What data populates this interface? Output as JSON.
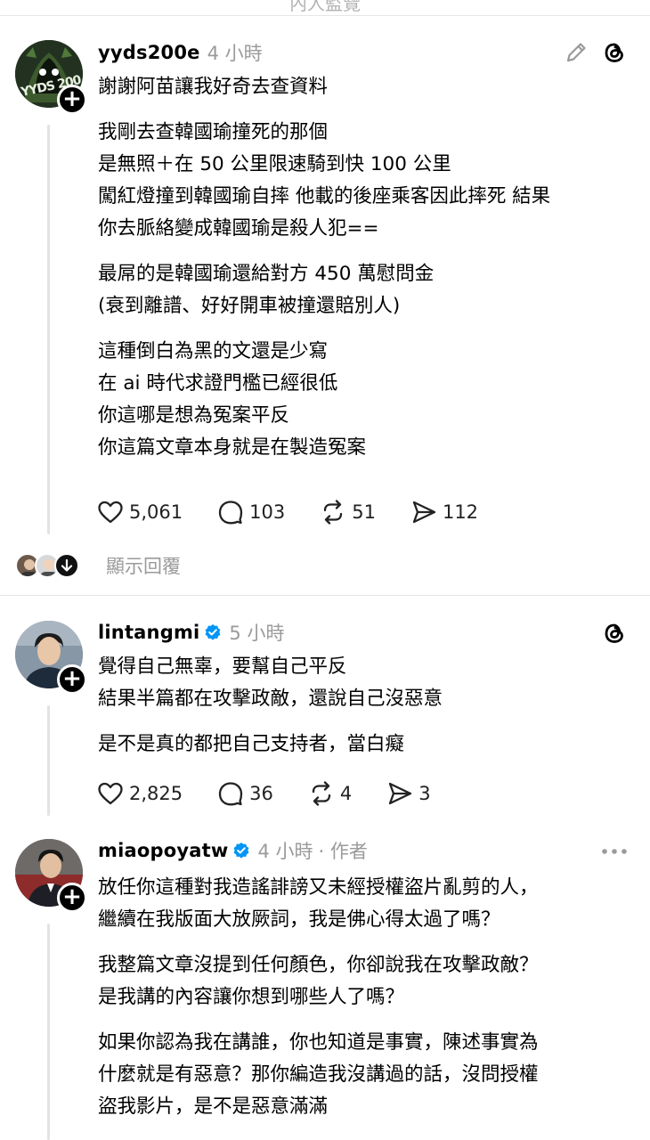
{
  "top_cut_text": "內人監覽",
  "posts": [
    {
      "username": "yyds200e",
      "time": "4 小時",
      "avatar_text": "YYDS 200",
      "paragraphs": [
        [
          "謝謝阿苗讓我好奇去查資料"
        ],
        [
          "我剛去查韓國瑜撞死的那個",
          "是無照＋在 50 公里限速騎到快 100 公里",
          "闖紅燈撞到韓國瑜自摔 他載的後座乘客因此摔死 結果",
          "你去脈絡變成韓國瑜是殺人犯=="
        ],
        [
          "最屌的是韓國瑜還給對方 450 萬慰問金",
          "(衰到離譜、好好開車被撞還賠別人)"
        ],
        [
          "這種倒白為黑的文還是少寫",
          "在 ai 時代求證門檻已經很低",
          "你這哪是想為冤案平反",
          "你這篇文章本身就是在製造冤案"
        ]
      ],
      "likes": "5,061",
      "comments": "103",
      "reposts": "51",
      "shares": "112",
      "show_replies": "顯示回覆"
    },
    {
      "username": "lintangmi",
      "time": "5 小時",
      "paragraphs": [
        [
          "覺得自己無辜，要幫自己平反",
          "結果半篇都在攻擊政敵，還說自己沒惡意"
        ],
        [
          "是不是真的都把自己支持者，當白癡"
        ]
      ],
      "likes": "2,825",
      "comments": "36",
      "reposts": "4",
      "shares": "3"
    },
    {
      "username": "miaopoyatw",
      "time": "4 小時",
      "author_tag": "· 作者",
      "paragraphs": [
        [
          "放任你這種對我造謠誹謗又未經授權盜片亂剪的人，",
          "繼續在我版面大放厥詞，我是佛心得太過了嗎？"
        ],
        [
          "我整篇文章沒提到任何顏色，你卻說我在攻擊政敵？",
          "是我講的內容讓你想到哪些人了嗎？"
        ],
        [
          "如果你認為我在講誰，你也知道是事實，陳述事實為",
          "什麼就是有惡意？那你編造我沒講過的話，沒問授權",
          "盜我影片，是不是惡意滿滿"
        ]
      ]
    }
  ],
  "colors": {
    "verified": "#0095f6",
    "muted": "#9a9a9a",
    "divider": "#e3e3e3"
  }
}
